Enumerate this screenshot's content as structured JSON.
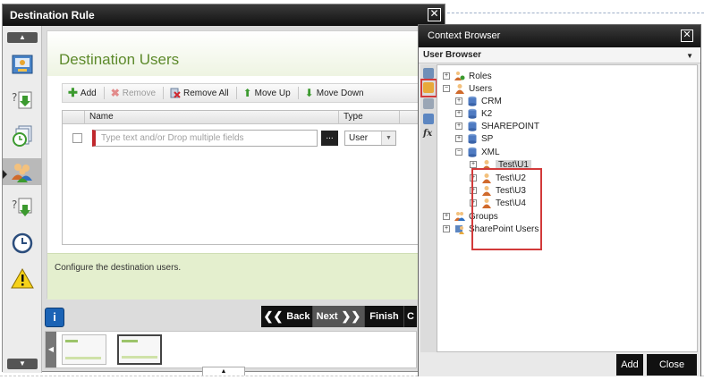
{
  "wizard": {
    "title": "Destination Rule",
    "content_title": "Destination Users",
    "toolbar": {
      "add": "Add",
      "remove": "Remove",
      "remove_all": "Remove All",
      "move_up": "Move Up",
      "move_down": "Move Down"
    },
    "grid": {
      "col_name": "Name",
      "col_type": "Type",
      "row_placeholder": "Type text and/or Drop multiple fields",
      "ellipsis": "...",
      "type_value": "User"
    },
    "info_text": "Configure the destination users.",
    "nav": {
      "back": "Back",
      "next": "Next",
      "finish": "Finish",
      "cut": "C"
    },
    "info_icon": "i",
    "rail_steps": [
      "wizard-icon",
      "import-icon",
      "pages-icon",
      "users-icon",
      "export-icon",
      "clock-icon",
      "warning-icon"
    ]
  },
  "context_browser": {
    "title": "Context Browser",
    "dropdown": "User Browser",
    "tree": [
      {
        "label": "Roles",
        "icon": "roles-icon",
        "expander": "+"
      },
      {
        "label": "Users",
        "icon": "user-icon",
        "expander": "−"
      },
      {
        "label": "CRM",
        "icon": "database-icon",
        "expander": "+"
      },
      {
        "label": "K2",
        "icon": "database-icon",
        "expander": "+"
      },
      {
        "label": "SHAREPOINT",
        "icon": "database-icon",
        "expander": "+"
      },
      {
        "label": "SP",
        "icon": "database-icon",
        "expander": "+"
      },
      {
        "label": "XML",
        "icon": "database-icon",
        "expander": "−"
      },
      {
        "label": "Test\\U1",
        "icon": "user-icon",
        "expander": "+"
      },
      {
        "label": "Test\\U2",
        "icon": "user-icon",
        "expander": "+"
      },
      {
        "label": "Test\\U3",
        "icon": "user-icon",
        "expander": "+"
      },
      {
        "label": "Test\\U4",
        "icon": "user-icon",
        "expander": "+"
      },
      {
        "label": "Groups",
        "icon": "groups-icon",
        "expander": "+"
      },
      {
        "label": "SharePoint Users",
        "icon": "sharepoint-users-icon",
        "expander": "+"
      }
    ],
    "buttons": {
      "add": "Add",
      "close": "Close"
    },
    "side_icons": [
      "browser-icon",
      "user-browser-icon",
      "object-icon",
      "workflow-icon",
      "function-icon"
    ]
  },
  "colors": {
    "title_green": "#5d8a2b",
    "highlight_red": "#d23a3a",
    "info_blue": "#1b63b5"
  }
}
